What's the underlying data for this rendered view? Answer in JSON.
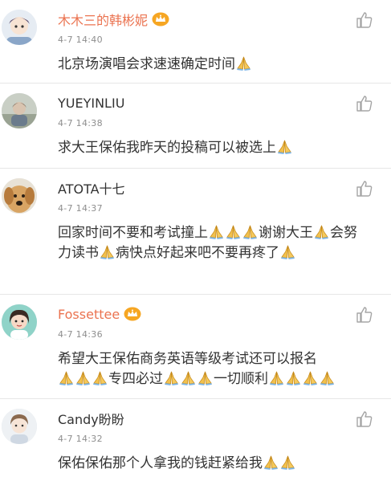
{
  "comments": [
    {
      "username": "木木三的韩彬妮",
      "vip": true,
      "time": "4-7 14:40",
      "text": "北京场演唱会求速速确定时间",
      "avatar": "cartoon-avatar",
      "emoji_suffix": 1
    },
    {
      "username": "YUEYINLIU",
      "vip": false,
      "time": "4-7 14:38",
      "text": "求大王保佑我昨天的投稿可以被选上",
      "avatar": "photo-avatar",
      "emoji_suffix": 1
    },
    {
      "username": "ATOTA十七",
      "vip": false,
      "time": "4-7 14:37",
      "text_parts": [
        "回家时间不要和考试撞上",
        "谢谢大王",
        "会努力读书",
        "病快点好起来吧不要再疼了"
      ],
      "avatar": "dog-avatar"
    },
    {
      "username": "Fossettee",
      "vip": true,
      "time": "4-7 14:36",
      "text_parts": [
        "希望大王保佑商务英语等级考试还可以报名",
        "专四必过",
        "一切顺利"
      ],
      "avatar": "girl-avatar"
    },
    {
      "username": "Candy盼盼",
      "vip": false,
      "time": "4-7 14:32",
      "text": "保佑保佑那个人拿我的钱赶紧给我",
      "avatar": "boy-avatar",
      "emoji_suffix": 2
    }
  ],
  "icons": {
    "like": "thumbs-up-icon",
    "emoji": "praying-hands-icon",
    "vip_badge": "crown-icon"
  },
  "colors": {
    "vip_name": "#eb7350",
    "name": "#333333",
    "time": "#8e8e8e",
    "divider": "#e6e6e6"
  }
}
